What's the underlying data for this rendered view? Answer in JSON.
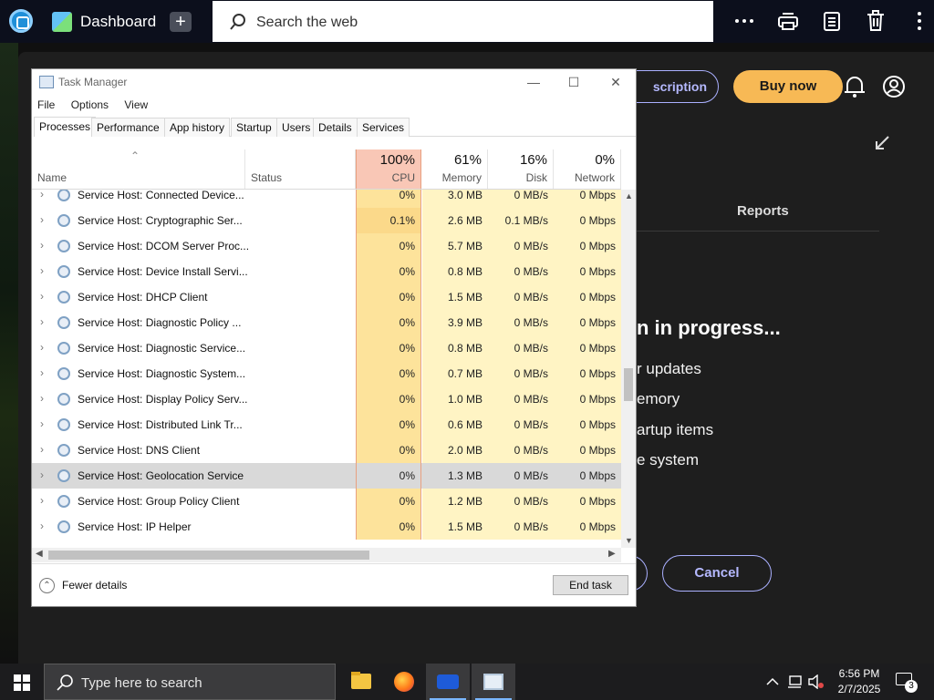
{
  "browser": {
    "tab_title": "Dashboard",
    "search_placeholder": "Search the web",
    "icons": [
      "more-icon",
      "print-icon",
      "clipboard-icon",
      "trash-icon",
      "kebab-icon"
    ]
  },
  "web_page": {
    "subscription_label": "scription",
    "buy_label": "Buy now",
    "reports_tab": "Reports",
    "progress_title": "n in progress...",
    "items": [
      "r updates",
      "emory",
      "artup items",
      "e system"
    ],
    "cancel_label": "Cancel"
  },
  "task_manager": {
    "title": "Task Manager",
    "menu": [
      "File",
      "Options",
      "View"
    ],
    "tabs": [
      "Processes",
      "Performance",
      "App history",
      "Startup",
      "Users",
      "Details",
      "Services"
    ],
    "active_tab": "Processes",
    "columns": {
      "name": "Name",
      "status": "Status",
      "cpu": {
        "pct": "100%",
        "label": "CPU"
      },
      "memory": {
        "pct": "61%",
        "label": "Memory"
      },
      "disk": {
        "pct": "16%",
        "label": "Disk"
      },
      "network": {
        "pct": "0%",
        "label": "Network"
      }
    },
    "rows": [
      {
        "name": "Service Host: Connected Device...",
        "cpu": "0%",
        "mem": "3.0 MB",
        "disk": "0 MB/s",
        "net": "0 Mbps"
      },
      {
        "name": "Service Host: Cryptographic Ser...",
        "cpu": "0.1%",
        "mem": "2.6 MB",
        "disk": "0.1 MB/s",
        "net": "0 Mbps"
      },
      {
        "name": "Service Host: DCOM Server Proc...",
        "cpu": "0%",
        "mem": "5.7 MB",
        "disk": "0 MB/s",
        "net": "0 Mbps"
      },
      {
        "name": "Service Host: Device Install Servi...",
        "cpu": "0%",
        "mem": "0.8 MB",
        "disk": "0 MB/s",
        "net": "0 Mbps"
      },
      {
        "name": "Service Host: DHCP Client",
        "cpu": "0%",
        "mem": "1.5 MB",
        "disk": "0 MB/s",
        "net": "0 Mbps"
      },
      {
        "name": "Service Host: Diagnostic Policy ...",
        "cpu": "0%",
        "mem": "3.9 MB",
        "disk": "0 MB/s",
        "net": "0 Mbps"
      },
      {
        "name": "Service Host: Diagnostic Service...",
        "cpu": "0%",
        "mem": "0.8 MB",
        "disk": "0 MB/s",
        "net": "0 Mbps"
      },
      {
        "name": "Service Host: Diagnostic System...",
        "cpu": "0%",
        "mem": "0.7 MB",
        "disk": "0 MB/s",
        "net": "0 Mbps"
      },
      {
        "name": "Service Host: Display Policy Serv...",
        "cpu": "0%",
        "mem": "1.0 MB",
        "disk": "0 MB/s",
        "net": "0 Mbps"
      },
      {
        "name": "Service Host: Distributed Link Tr...",
        "cpu": "0%",
        "mem": "0.6 MB",
        "disk": "0 MB/s",
        "net": "0 Mbps"
      },
      {
        "name": "Service Host: DNS Client",
        "cpu": "0%",
        "mem": "2.0 MB",
        "disk": "0 MB/s",
        "net": "0 Mbps"
      },
      {
        "name": "Service Host: Geolocation Service",
        "cpu": "0%",
        "mem": "1.3 MB",
        "disk": "0 MB/s",
        "net": "0 Mbps",
        "selected": true
      },
      {
        "name": "Service Host: Group Policy Client",
        "cpu": "0%",
        "mem": "1.2 MB",
        "disk": "0 MB/s",
        "net": "0 Mbps"
      },
      {
        "name": "Service Host: IP Helper",
        "cpu": "0%",
        "mem": "1.5 MB",
        "disk": "0 MB/s",
        "net": "0 Mbps"
      }
    ],
    "fewer_details": "Fewer details",
    "end_task": "End task"
  },
  "taskbar": {
    "search_placeholder": "Type here to search",
    "time": "6:56 PM",
    "date": "2/7/2025",
    "notification_count": "3"
  },
  "colors": {
    "cpu_header": "#f9c7b6",
    "cpu_cell": "#fde39b",
    "other_cell": "#fff4c4",
    "accent": "#f7b955"
  }
}
